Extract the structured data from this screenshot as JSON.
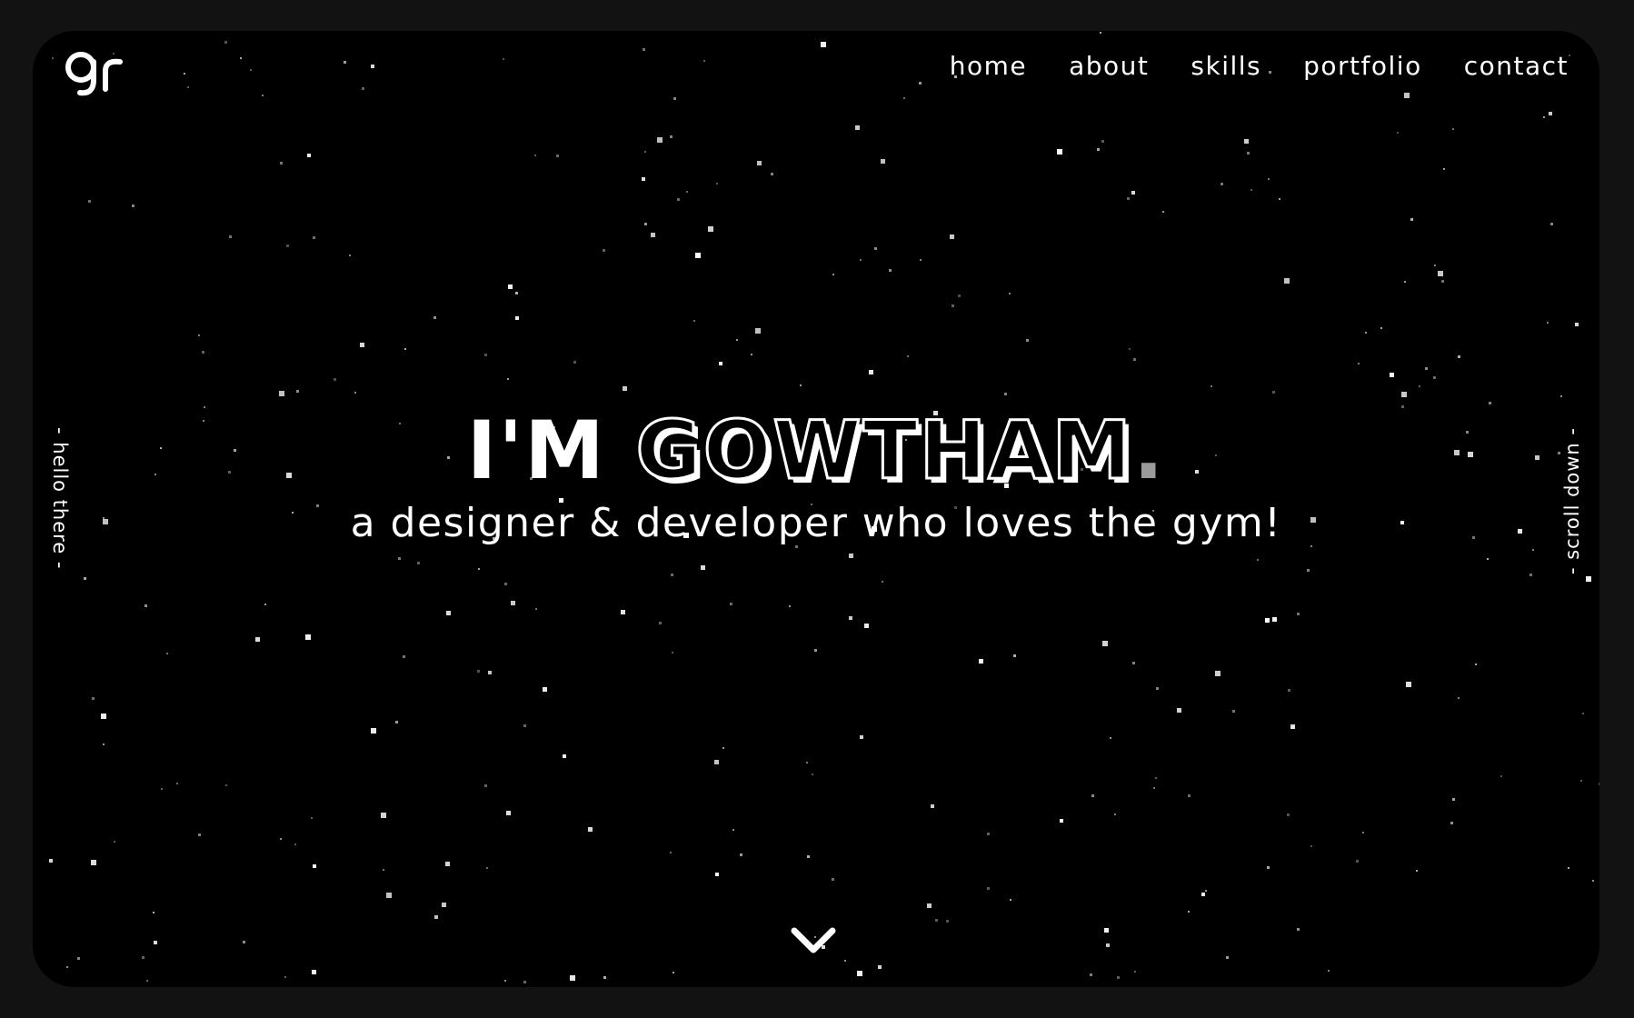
{
  "logo": {
    "text": "gr",
    "icon": "gr-monogram-logo"
  },
  "nav": {
    "items": [
      {
        "label": "home"
      },
      {
        "label": "about"
      },
      {
        "label": "skills"
      },
      {
        "label": "portfolio"
      },
      {
        "label": "contact"
      }
    ]
  },
  "side": {
    "left_label": "- hello there -",
    "right_label": "- scroll down -"
  },
  "hero": {
    "prefix": "I'M ",
    "name": "GOWTHAM",
    "dot": ".",
    "subtitle": "a designer & developer who loves the gym!"
  },
  "scroll": {
    "icon": "chevron-down-icon"
  },
  "colors": {
    "page_background": "#121212",
    "hero_background": "#000000",
    "text": "#ffffff",
    "accent_dot": "#9a9a9a"
  }
}
